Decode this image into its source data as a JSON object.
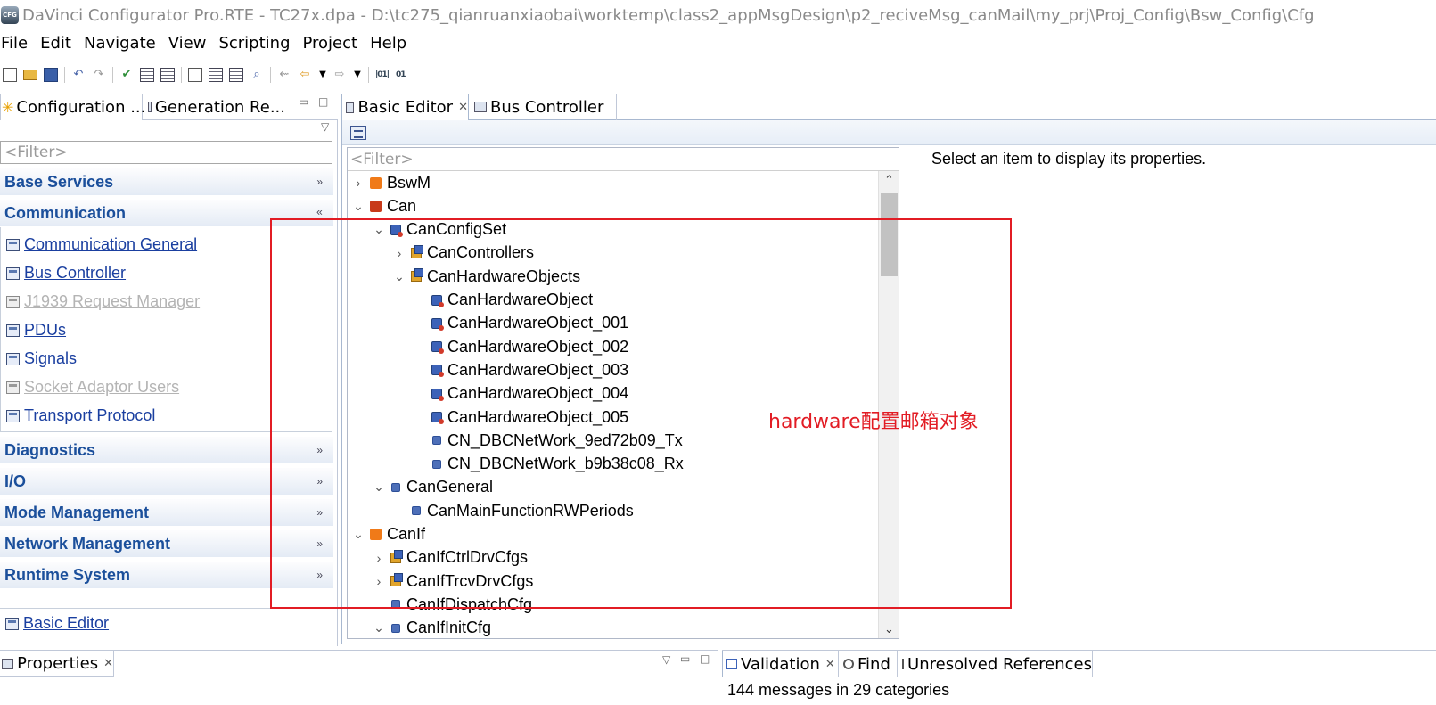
{
  "window": {
    "title": "DaVinci Configurator Pro.RTE - TC27x.dpa - D:\\tc275_qianruanxiaobai\\worktemp\\class2_appMsgDesign\\p2_reciveMsg_canMail\\my_prj\\Proj_Config\\Bsw_Config\\Cfg",
    "logo_text": "CFG"
  },
  "menu": [
    "File",
    "Edit",
    "Navigate",
    "View",
    "Scripting",
    "Project",
    "Help"
  ],
  "left_tabs": {
    "configuration": "Configuration ...",
    "generation": "Generation Re..."
  },
  "left_panel": {
    "filter_placeholder": "<Filter>",
    "sections": {
      "base_services": "Base Services",
      "communication": "Communication",
      "diagnostics": "Diagnostics",
      "io": "I/O",
      "mode_management": "Mode Management",
      "network_management": "Network Management",
      "runtime_system": "Runtime System"
    },
    "communication_items": [
      {
        "label": "Communication General",
        "enabled": true
      },
      {
        "label": "Bus Controller",
        "enabled": true
      },
      {
        "label": "J1939 Request Manager",
        "enabled": false
      },
      {
        "label": "PDUs",
        "enabled": true
      },
      {
        "label": "Signals",
        "enabled": true
      },
      {
        "label": "Socket Adaptor Users",
        "enabled": false
      },
      {
        "label": "Transport Protocol",
        "enabled": true
      }
    ],
    "basic_editor_link": "Basic Editor"
  },
  "editor_tabs": {
    "basic_editor": "Basic Editor",
    "bus_controller": "Bus Controller"
  },
  "tree": {
    "filter_placeholder": "<Filter>",
    "rows": [
      {
        "label": "BswM",
        "level": 0,
        "twist": "›",
        "icon": "module"
      },
      {
        "label": "Can",
        "level": 0,
        "twist": "⌄",
        "icon": "module red"
      },
      {
        "label": "CanConfigSet",
        "level": 1,
        "twist": "⌄",
        "icon": "container"
      },
      {
        "label": "CanControllers",
        "level": 2,
        "twist": "›",
        "icon": "multi"
      },
      {
        "label": "CanHardwareObjects",
        "level": 2,
        "twist": "⌄",
        "icon": "multi"
      },
      {
        "label": "CanHardwareObject",
        "level": 3,
        "twist": "",
        "icon": "container"
      },
      {
        "label": "CanHardwareObject_001",
        "level": 3,
        "twist": "",
        "icon": "container"
      },
      {
        "label": "CanHardwareObject_002",
        "level": 3,
        "twist": "",
        "icon": "container"
      },
      {
        "label": "CanHardwareObject_003",
        "level": 3,
        "twist": "",
        "icon": "container"
      },
      {
        "label": "CanHardwareObject_004",
        "level": 3,
        "twist": "",
        "icon": "container"
      },
      {
        "label": "CanHardwareObject_005",
        "level": 3,
        "twist": "",
        "icon": "container"
      },
      {
        "label": "CN_DBCNetWork_9ed72b09_Tx",
        "level": 3,
        "twist": "",
        "icon": "param"
      },
      {
        "label": "CN_DBCNetWork_b9b38c08_Rx",
        "level": 3,
        "twist": "",
        "icon": "param"
      },
      {
        "label": "CanGeneral",
        "level": 1,
        "twist": "⌄",
        "icon": "param"
      },
      {
        "label": "CanMainFunctionRWPeriods",
        "level": 2,
        "twist": "",
        "icon": "param"
      },
      {
        "label": "CanIf",
        "level": 0,
        "twist": "⌄",
        "icon": "module"
      },
      {
        "label": "CanIfCtrlDrvCfgs",
        "level": 1,
        "twist": "›",
        "icon": "multi"
      },
      {
        "label": "CanIfTrcvDrvCfgs",
        "level": 1,
        "twist": "›",
        "icon": "multi"
      },
      {
        "label": "CanIfDispatchCfg",
        "level": 1,
        "twist": "",
        "icon": "param"
      },
      {
        "label": "CanIfInitCfg",
        "level": 1,
        "twist": "⌄",
        "icon": "param"
      }
    ]
  },
  "properties_message": "Select an item to display its properties.",
  "annotation": "hardware配置邮箱对象",
  "bottom_left": {
    "properties_tab": "Properties"
  },
  "bottom_right": {
    "validation_tab": "Validation",
    "find_tab": "Find",
    "unresolved_tab": "Unresolved References",
    "message_count": "144 messages in 29 categories"
  },
  "colors": {
    "section_header_text": "#1b4f9b",
    "link": "#1a3fa0",
    "annotation": "#e21c24",
    "disabled": "#b4b4b4"
  }
}
